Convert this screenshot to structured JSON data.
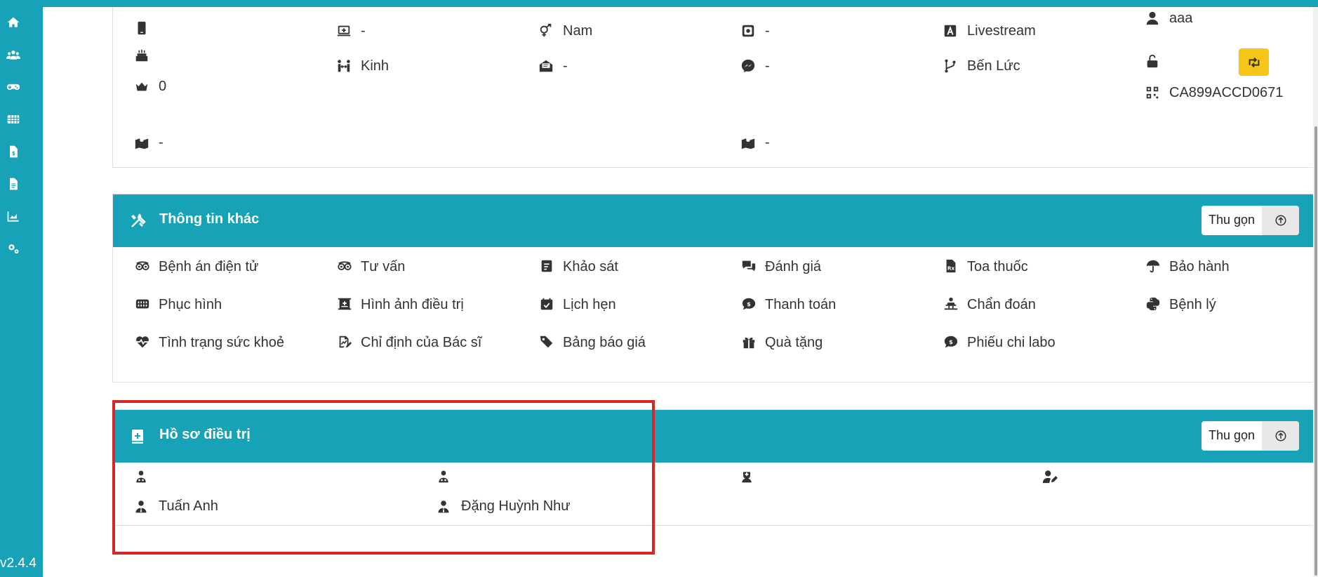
{
  "version": "v2.4.4",
  "sidebar": {
    "icons": [
      "home-icon",
      "users-icon",
      "gamepad-icon",
      "grid-icon",
      "invoice-icon",
      "document-icon",
      "chart-icon",
      "settings-icon"
    ]
  },
  "customer": {
    "phone": "",
    "birthday": "",
    "points": "0",
    "address": "-",
    "device": "-",
    "ethnicity": "Kinh",
    "gender": "Nam",
    "email": "-",
    "instagram": "-",
    "messenger": "-",
    "address2": "-",
    "source": "Livestream",
    "branch": "Bến Lức",
    "user": "aaa",
    "code": "CA899ACCD0671"
  },
  "other_info": {
    "title": "Thông tin khác",
    "collapse_label": "Thu gọn",
    "links": [
      {
        "label": "Bệnh án điện tử",
        "icon": "tripadvisor-icon"
      },
      {
        "label": "Tư vấn",
        "icon": "tripadvisor-icon"
      },
      {
        "label": "Khảo sát",
        "icon": "survey-icon"
      },
      {
        "label": "Đánh giá",
        "icon": "comments-icon"
      },
      {
        "label": "Toa thuốc",
        "icon": "prescription-icon"
      },
      {
        "label": "Bảo hành",
        "icon": "umbrella-icon"
      },
      {
        "label": "Phục hình",
        "icon": "teeth-icon"
      },
      {
        "label": "Hình ảnh điều trị",
        "icon": "clinic-image-icon"
      },
      {
        "label": "Lịch hẹn",
        "icon": "calendar-check-icon"
      },
      {
        "label": "Thanh toán",
        "icon": "payment-comment-icon"
      },
      {
        "label": "Chẩn đoán",
        "icon": "diagnosis-icon"
      },
      {
        "label": "Bệnh lý",
        "icon": "python-icon"
      },
      {
        "label": "Tình trạng sức khoẻ",
        "icon": "heartbeat-icon"
      },
      {
        "label": "Chỉ định của Bác sĩ",
        "icon": "signature-icon"
      },
      {
        "label": "Bảng báo giá",
        "icon": "tags-icon"
      },
      {
        "label": "Quà tặng",
        "icon": "gift-icon"
      },
      {
        "label": "Phiếu chi labo",
        "icon": "payment-comment-icon"
      }
    ]
  },
  "treatment_records": {
    "title": "Hồ sơ điều trị",
    "collapse_label": "Thu gọn",
    "doctor1": "Tuấn Anh",
    "doctor2": "Đặng Huỳnh Như"
  },
  "colors": {
    "primary": "#17a2b8",
    "accent_yellow": "#f5c518",
    "highlight_red": "#d62728"
  }
}
